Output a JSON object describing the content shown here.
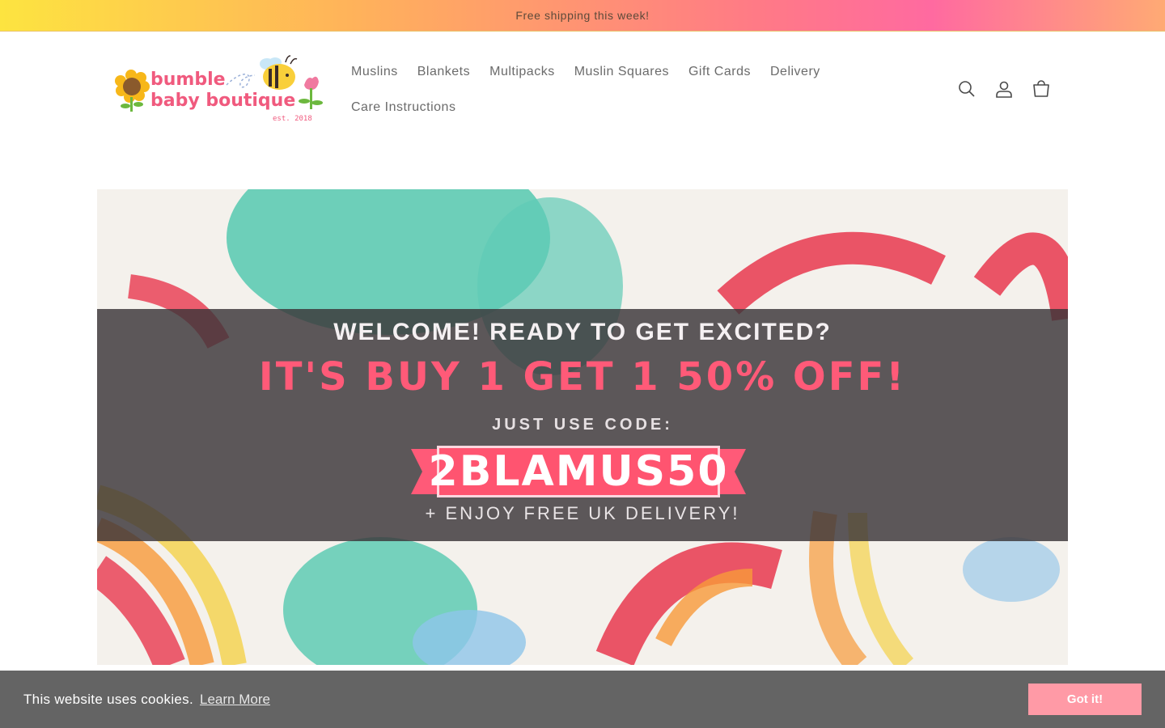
{
  "announcement": {
    "text": "Free shipping this week!"
  },
  "brand": {
    "line1": "bumble",
    "line2": "baby boutique",
    "established": "est. 2018"
  },
  "nav": {
    "items": [
      {
        "label": "Muslins"
      },
      {
        "label": "Blankets"
      },
      {
        "label": "Multipacks"
      },
      {
        "label": "Muslin Squares"
      },
      {
        "label": "Gift Cards"
      },
      {
        "label": "Delivery"
      },
      {
        "label": "Care Instructions"
      }
    ]
  },
  "header_icons": [
    "search-icon",
    "account-icon",
    "cart-icon"
  ],
  "hero": {
    "line1": "WELCOME! READY TO GET EXCITED?",
    "line2": "IT'S BUY 1 GET 1 50% OFF!",
    "line3": "JUST USE CODE:",
    "code": "2BLAMUS50",
    "line4": "+ ENJOY FREE UK DELIVERY!"
  },
  "cookie": {
    "message": "This website uses cookies.",
    "learn_more": "Learn More",
    "accept": "Got it!"
  },
  "colors": {
    "accent_pink": "#ff5a78",
    "cookie_button": "#ff9aa6",
    "cookie_bar": "#646464"
  }
}
